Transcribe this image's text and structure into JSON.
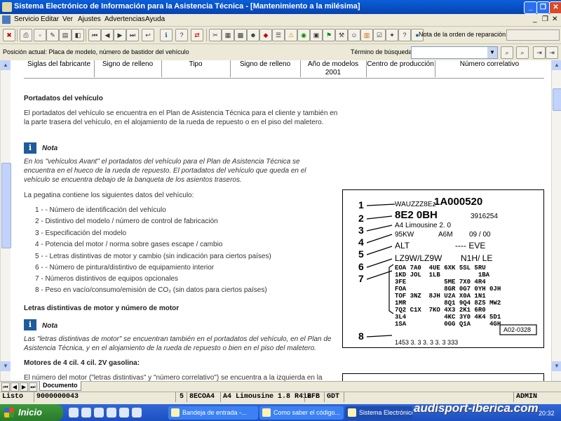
{
  "window": {
    "title": "Sistema Electrónico de Información para la Asistencia Técnica - [Mantenimiento a la milésima]"
  },
  "menu": [
    "Servicio",
    "Editar",
    "Ver",
    "Ajustes",
    "Advertencias",
    "Ayuda"
  ],
  "toolbar": {
    "order_note_label": "Nota de la orden de reparación:"
  },
  "position_bar": {
    "label": "Posición actual: Placa de modelo, número de bastidor del vehículo",
    "search_label": "Término de búsqueda:",
    "search_value": ""
  },
  "document": {
    "columns": [
      "Siglas del fabricante",
      "Signo de relleno",
      "Tipo",
      "Signo de relleno",
      "Año de modelos 2001",
      "Centro de producción",
      "Número correlativo"
    ],
    "section1_title": "Portadatos del vehículo",
    "section1_body": "El portadatos del vehículo se encuentra en el Plan de Asistencia Técnica para el cliente y también en la parte trasera del vehículo, en el alojamiento de la rueda de repuesto o en el piso del maletero.",
    "note1_label": "Nota",
    "note1_text": "En los \"vehículos Avant\" el portadatos del vehículo para el Plan de Asistencia Técnica se encuentra en el hueco de la rueda de repuesto. El portadatos del vehículo que queda en el vehículo se encuentra debajo de la banqueta de los asientos traseros.",
    "sticker_intro": "La pegatina contiene los siguientes datos del vehículo:",
    "list": [
      "1 - - Número de identificación del vehículo",
      "2 - Distintivo del modelo / número de control de fabricación",
      "3 - Especificación del modelo",
      "4 - Potencia del motor / norma sobre gases escape / cambio",
      "5 - - Letras distintivas de motor y cambio (sin indicación para ciertos países)",
      "6 - - Número de pintura/distintivo de equipamiento interior",
      "7 - Números distintivos de equipos opcionales",
      "8 - Peso en vacío/consumo/emisión de CO₂ (sin datos para ciertos países)"
    ],
    "section2_title": "Letras distintivas de motor y número de motor",
    "note2_label": "Nota",
    "note2_text": "Las \"letras distintivas de motor\" se encuentran también en el portadatos del vehículo, en el Plan de Asistencia Técnica, y en el alojamiento de la rueda de repuesto o bien en el piso del maletero.",
    "section3_title": "Motores de 4 cil. 4 cil. 2V gasolina:",
    "section3_body": "El número del motor (\"letras distintivas\" y \"número correlativo\") se encuentra a la izquierda en la"
  },
  "plate": {
    "callouts": [
      "1",
      "2",
      "3",
      "4",
      "5",
      "6",
      "7",
      "8"
    ],
    "vin_prefix": "WAUZZZ8Ez",
    "vin_suffix": "1A000520",
    "model_code": "8E2 0BH",
    "control_no": "3916254",
    "model_name": "A4  Limousine    2. 0",
    "power": "95KW",
    "gearbox": "A6M",
    "emission": "09 / 00",
    "engine": "ALT",
    "trans": "---- EVE",
    "paint": "LZ9W/LZ9W",
    "interior": "N1H/ LE",
    "options_grid": "EOA 7A0  4UE 6XK 5SL 5RU\n1KD JOL  1LB          1BA\n3FE          5ME 7X0 4R4\nFOA          8GR 0G7 0YH 0JH\nTOF 3NZ  8JH U2A X0A 1N1\n1MR          8Q1 9Q4 8Z5 MW2\n7Q2 C1X  7KO 4X3 2K1 6R0\n3L4          4KC 3Y0 4K4 5D1\n1SA          0GG Q1A     4GH",
    "weights": "1453    3. 3    3. 3    3. 3    333",
    "figure_id": "A02-0328"
  },
  "tab": {
    "label": "Documento"
  },
  "status": {
    "state": "Listo",
    "order": "9000000043",
    "qty": "5",
    "code": "8ECOA4",
    "model": "A4 Limousine 1.8 R412",
    "engine": "BFB",
    "gear": "GDT",
    "user": "ADMIN"
  },
  "taskbar": {
    "start": "Inicio",
    "tasks": [
      "Bandeja de entrada -...",
      "Como saber el código...",
      "Sistema Electrónico d..."
    ],
    "watermark": "audisport-iberica.com",
    "clock": "20:32"
  }
}
